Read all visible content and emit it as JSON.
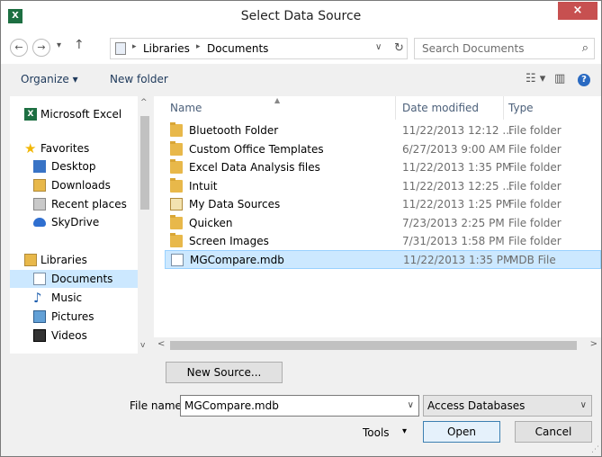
{
  "window": {
    "title": "Select Data Source",
    "app_icon": "X",
    "close_glyph": "×"
  },
  "navigation": {
    "back_glyph": "←",
    "forward_glyph": "→",
    "recent_glyph": "▾",
    "up_glyph": "↑",
    "breadcrumb": [
      "Libraries",
      "Documents"
    ],
    "breadcrumb_sep": "▸",
    "dropdown_glyph": "∨",
    "refresh_glyph": "↻",
    "search_placeholder": "Search Documents",
    "search_glyph": "⌕"
  },
  "toolbar": {
    "organize_label": "Organize ▾",
    "new_folder_label": "New folder",
    "view_glyph": "☷ ▾",
    "preview_glyph": "▥",
    "help_glyph": "?"
  },
  "sidebar": {
    "items": [
      {
        "label": "Microsoft Excel",
        "icon": "excel-icon"
      },
      {
        "label": "Favorites",
        "icon": "star-icon"
      },
      {
        "label": "Desktop",
        "icon": "desktop-icon"
      },
      {
        "label": "Downloads",
        "icon": "downloads-icon"
      },
      {
        "label": "Recent places",
        "icon": "recent-places-icon"
      },
      {
        "label": "SkyDrive",
        "icon": "skydrive-icon"
      },
      {
        "label": "Libraries",
        "icon": "libraries-icon"
      },
      {
        "label": "Documents",
        "icon": "documents-icon"
      },
      {
        "label": "Music",
        "icon": "music-icon"
      },
      {
        "label": "Pictures",
        "icon": "pictures-icon"
      },
      {
        "label": "Videos",
        "icon": "videos-icon"
      }
    ],
    "selected": "Documents"
  },
  "file_list": {
    "columns": [
      "Name",
      "Date modified",
      "Type"
    ],
    "sort_glyph": "▲",
    "rows": [
      {
        "name": "Bluetooth Folder",
        "date": "11/22/2013 12:12 ...",
        "type": "File folder",
        "icon": "folder-icon"
      },
      {
        "name": "Custom Office Templates",
        "date": "6/27/2013 9:00 AM",
        "type": "File folder",
        "icon": "folder-icon"
      },
      {
        "name": "Excel Data Analysis files",
        "date": "11/22/2013 1:35 PM",
        "type": "File folder",
        "icon": "folder-icon"
      },
      {
        "name": "Intuit",
        "date": "11/22/2013 12:25 ...",
        "type": "File folder",
        "icon": "folder-icon"
      },
      {
        "name": "My Data Sources",
        "date": "11/22/2013 1:25 PM",
        "type": "File folder",
        "icon": "data-sources-folder-icon"
      },
      {
        "name": "Quicken",
        "date": "7/23/2013 2:25 PM",
        "type": "File folder",
        "icon": "folder-icon"
      },
      {
        "name": "Screen Images",
        "date": "7/31/2013 1:58 PM",
        "type": "File folder",
        "icon": "folder-icon"
      },
      {
        "name": "MGCompare.mdb",
        "date": "11/22/2013 1:35 PM",
        "type": "MDB File",
        "icon": "mdb-file-icon"
      }
    ],
    "selected_row": 7
  },
  "scroll": {
    "up_glyph": "^",
    "down_glyph": "v",
    "left_glyph": "<",
    "right_glyph": ">"
  },
  "actions": {
    "new_source_label": "New Source...",
    "file_name_label": "File name:",
    "file_name_value": "MGCompare.mdb",
    "file_type_value": "Access Databases",
    "tools_label": "Tools",
    "open_label": "Open",
    "cancel_label": "Cancel",
    "combo_glyph": "∨",
    "tools_glyph": "▾"
  }
}
